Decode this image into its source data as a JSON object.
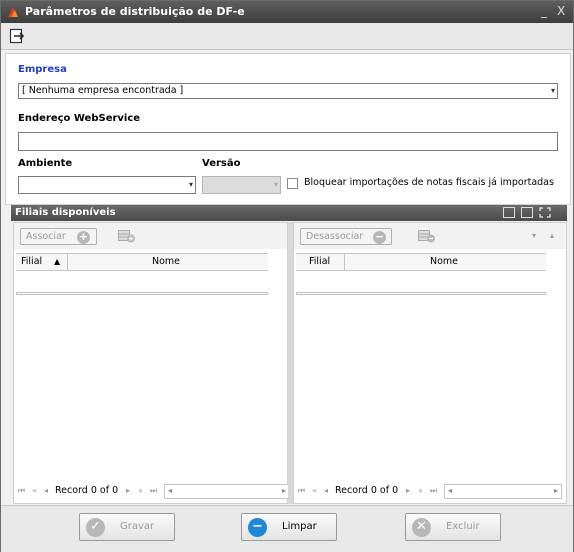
{
  "window": {
    "title": "Parâmetros de distribuição de DF-e",
    "minimize": "_",
    "close": "X"
  },
  "form": {
    "empresa_label": "Empresa",
    "empresa_value": "[ Nenhuma empresa encontrada ]",
    "webservice_label": "Endereço WebService",
    "webservice_value": "",
    "ambiente_label": "Ambiente",
    "ambiente_value": "",
    "versao_label": "Versão",
    "versao_value": "",
    "bloquear_label": "Bloquear importações de notas fiscais já importadas",
    "bloquear_checked": false
  },
  "section": {
    "title": "Filiais disponíveis"
  },
  "left_pane": {
    "button_label": "Associar",
    "columns": [
      "Filial",
      "Nome"
    ],
    "sort_indicator": "▲",
    "record_text": "Record 0 of 0"
  },
  "right_pane": {
    "button_label": "Desassociar",
    "columns": [
      "Filial",
      "Nome"
    ],
    "record_text": "Record 0 of 0"
  },
  "footer": {
    "gravar": "Gravar",
    "limpar": "Limpar",
    "excluir": "Excluir"
  },
  "icons": {
    "title": "app-logo-icon",
    "exit": "exit-icon"
  },
  "colors": {
    "titlebar": "#4a4a4a",
    "label_blue": "#1f3fbf",
    "limpar_icon": "#1e88d6",
    "disabled_icon": "#b7b7b7"
  }
}
